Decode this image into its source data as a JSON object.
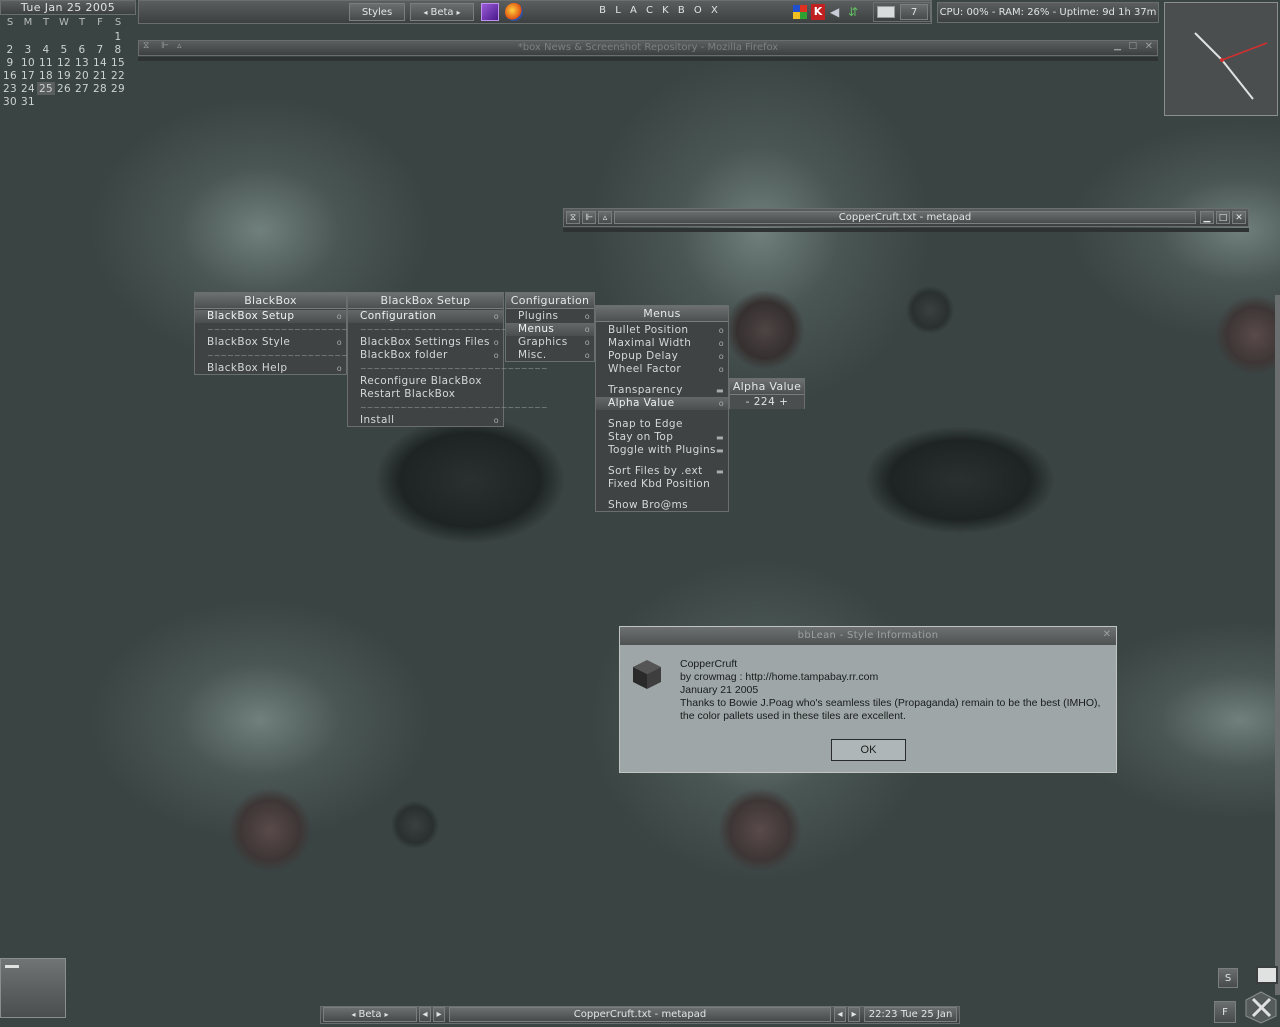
{
  "calendar": {
    "header": "Tue Jan 25 2005",
    "weekdays": [
      "S",
      "M",
      "T",
      "W",
      "T",
      "F",
      "S"
    ],
    "weeks": [
      [
        "",
        "",
        "",
        "",
        "",
        "",
        "1"
      ],
      [
        "2",
        "3",
        "4",
        "5",
        "6",
        "7",
        "8"
      ],
      [
        "9",
        "10",
        "11",
        "12",
        "13",
        "14",
        "15"
      ],
      [
        "16",
        "17",
        "18",
        "19",
        "20",
        "21",
        "22"
      ],
      [
        "23",
        "24",
        "25",
        "26",
        "27",
        "28",
        "29"
      ],
      [
        "30",
        "31",
        "",
        "",
        "",
        "",
        ""
      ]
    ],
    "today": "25"
  },
  "toolbar": {
    "styles_label": "Styles",
    "workspace_label": "Beta",
    "title": "B L A C K B O X",
    "mail_count": "7",
    "stats": "CPU: 00% - RAM: 26% - Uptime: 9d 1h 37m"
  },
  "firefox": {
    "title": "*box News & Screenshot Repository - Mozilla Firefox"
  },
  "metapad": {
    "title": "CopperCruft.txt - metapad"
  },
  "menus": {
    "blackbox": {
      "title": "BlackBox",
      "items": [
        {
          "label": "BlackBox Setup",
          "mark": "o",
          "selected": true
        },
        {
          "label": "~~~~~~~~~~~~~~~~~~~~~~~~~~~~",
          "sep": true
        },
        {
          "label": "BlackBox Style",
          "mark": "o"
        },
        {
          "label": "~~~~~~~~~~~~~~~~~~~~~~~~~~~~",
          "sep": true
        },
        {
          "label": "BlackBox Help",
          "mark": "o"
        }
      ]
    },
    "setup": {
      "title": "BlackBox Setup",
      "items": [
        {
          "label": "Configuration",
          "mark": "o",
          "selected": true
        },
        {
          "label": "~~~~~~~~~~~~~~~~~~~~~~~~~~~~",
          "sep": true
        },
        {
          "label": "BlackBox Settings Files",
          "mark": "o"
        },
        {
          "label": "BlackBox folder",
          "mark": "o"
        },
        {
          "label": "~~~~~~~~~~~~~~~~~~~~~~~~~~~~",
          "sep": true
        },
        {
          "label": "Reconfigure BlackBox"
        },
        {
          "label": "Restart BlackBox"
        },
        {
          "label": "~~~~~~~~~~~~~~~~~~~~~~~~~~~~",
          "sep": true
        },
        {
          "label": "Install",
          "mark": "o"
        }
      ]
    },
    "configuration": {
      "title": "Configuration",
      "items": [
        {
          "label": "Plugins",
          "mark": "o"
        },
        {
          "label": "Menus",
          "mark": "o",
          "selected": true
        },
        {
          "label": "Graphics",
          "mark": "o"
        },
        {
          "label": "Misc.",
          "mark": "o"
        }
      ]
    },
    "menus": {
      "title": "Menus",
      "items": [
        {
          "label": "Bullet Position",
          "mark": "o"
        },
        {
          "label": "Maximal Width",
          "mark": "o"
        },
        {
          "label": "Popup Delay",
          "mark": "o"
        },
        {
          "label": "Wheel Factor",
          "mark": "o"
        },
        {
          "label": "",
          "sep": true
        },
        {
          "label": "Transparency",
          "mark": "▬"
        },
        {
          "label": "Alpha Value",
          "mark": "o",
          "selected": true
        },
        {
          "label": "",
          "sep": true
        },
        {
          "label": "Snap to Edge"
        },
        {
          "label": "Stay on Top",
          "mark": "▬"
        },
        {
          "label": "Toggle with Plugins",
          "mark": "▬"
        },
        {
          "label": "",
          "sep": true
        },
        {
          "label": "Sort Files by .ext",
          "mark": "▬"
        },
        {
          "label": "Fixed Kbd Position"
        },
        {
          "label": "",
          "sep": true
        },
        {
          "label": "Show Bro@ms"
        }
      ]
    },
    "alpha": {
      "title": "Alpha Value",
      "value": "- 224 +"
    }
  },
  "dialog": {
    "title": "bbLean - Style Information",
    "lines": [
      "CopperCruft",
      "by crowmag : http://home.tampabay.rr.com",
      "January 21 2005",
      "Thanks to Bowie J.Poag who's seamless tiles (Propaganda) remain to be the best (IMHO),",
      "the color pallets used in these tiles are excellent."
    ],
    "ok_label": "OK"
  },
  "taskbar": {
    "workspace_label": "Beta",
    "task_label": "CopperCruft.txt - metapad",
    "clock": "22:23 Tue 25 Jan"
  },
  "tray": {
    "s_label": "S",
    "f_label": "F"
  },
  "colors": {
    "desktop": "#3a4443",
    "accent_red": "#d03030"
  }
}
